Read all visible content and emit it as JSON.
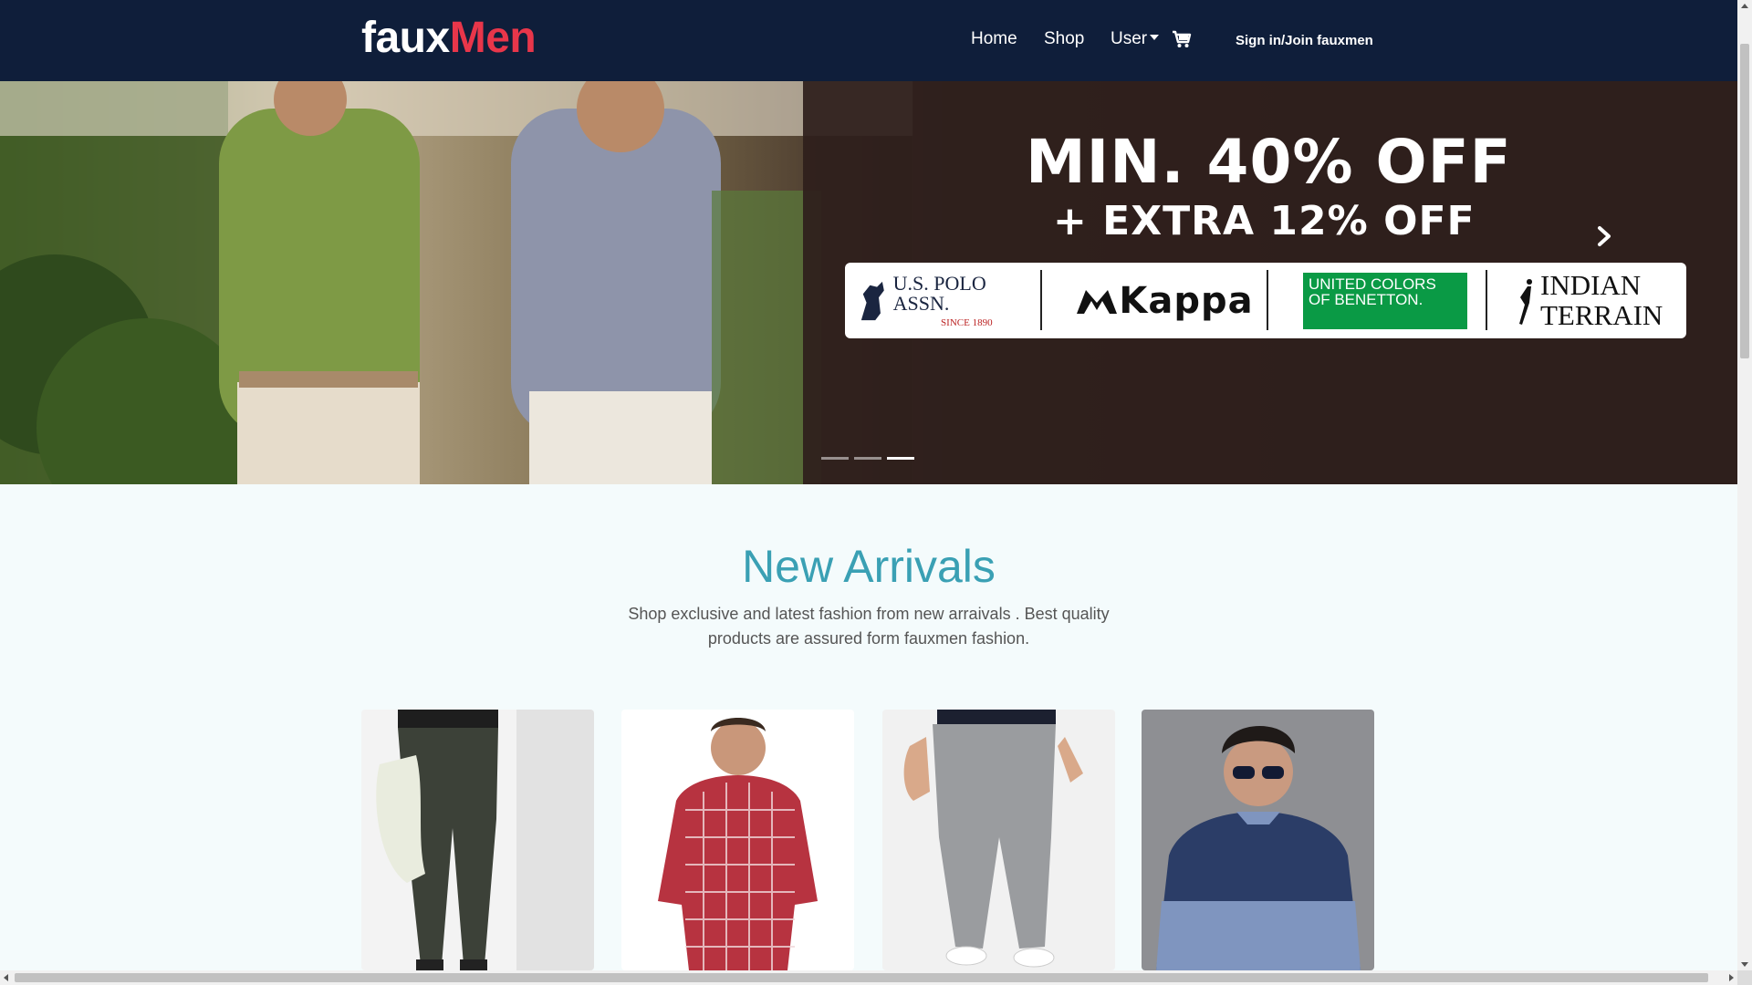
{
  "navbar": {
    "brand_part1": "faux",
    "brand_part2": "Men",
    "links": {
      "home": "Home",
      "shop": "Shop",
      "user": "User"
    },
    "signin": "Sign in/Join fauxmen",
    "icons": [
      "cart-icon",
      "caret-down-icon"
    ]
  },
  "hero": {
    "promo_line1": "MIN. 40% OFF",
    "promo_line2": "+ EXTRA 12% OFF",
    "brands": {
      "polo_line1": "U.S. POLO ASSN.",
      "polo_line2": "SINCE 1890",
      "kappa": "Kappa",
      "benetton": "UNITED COLORS OF BENETTON.",
      "indian_line1": "INDIAN",
      "indian_line2": "TERRAIN"
    },
    "slide_count": 3,
    "active_slide": 3
  },
  "arrivals": {
    "title": "New Arrivals",
    "description": "Shop exclusive and latest fashion from new arraivals . Best quality products are assured form fauxmen fashion."
  },
  "products": [
    {
      "kind": "olive trousers",
      "icon": "product-image"
    },
    {
      "kind": "red checked shirt",
      "icon": "product-image"
    },
    {
      "kind": "grey jeans",
      "icon": "product-image"
    },
    {
      "kind": "blue sweatshirt",
      "icon": "product-image"
    }
  ],
  "colors": {
    "navbar": "#0f1e3a",
    "brand_accent": "#e8364a",
    "title_accent": "#3aa0b4",
    "benetton_green": "#0a9a45"
  }
}
